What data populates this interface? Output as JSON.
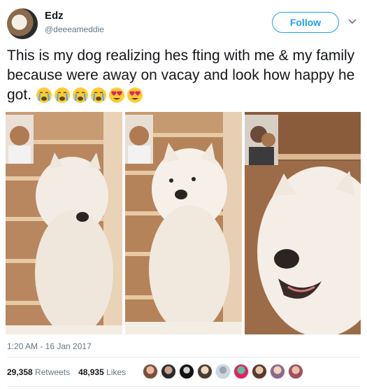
{
  "author": {
    "name": "Edz",
    "handle": "@deeeameddie",
    "follow_label": "Follow"
  },
  "tweet": {
    "text": "This is my dog realizing hes fting with me & my family because were away on vacay and look how happy he got.",
    "emojis": [
      "crying-face",
      "crying-face",
      "crying-face",
      "crying-face",
      "heart-eyes-face",
      "heart-eyes-face"
    ],
    "timestamp": "1:20 AM - 16 Jan 2017"
  },
  "stats": {
    "retweets_count": "29,358",
    "retweets_label": "Retweets",
    "likes_count": "48,935",
    "likes_label": "Likes"
  },
  "likers": [
    "avatar-1",
    "avatar-2",
    "avatar-3",
    "avatar-4",
    "avatar-5",
    "avatar-6",
    "avatar-7",
    "avatar-8",
    "avatar-9"
  ],
  "colors": {
    "accent": "#1da1f2",
    "secondary_text": "#657786",
    "divider": "#e6ecf0"
  }
}
